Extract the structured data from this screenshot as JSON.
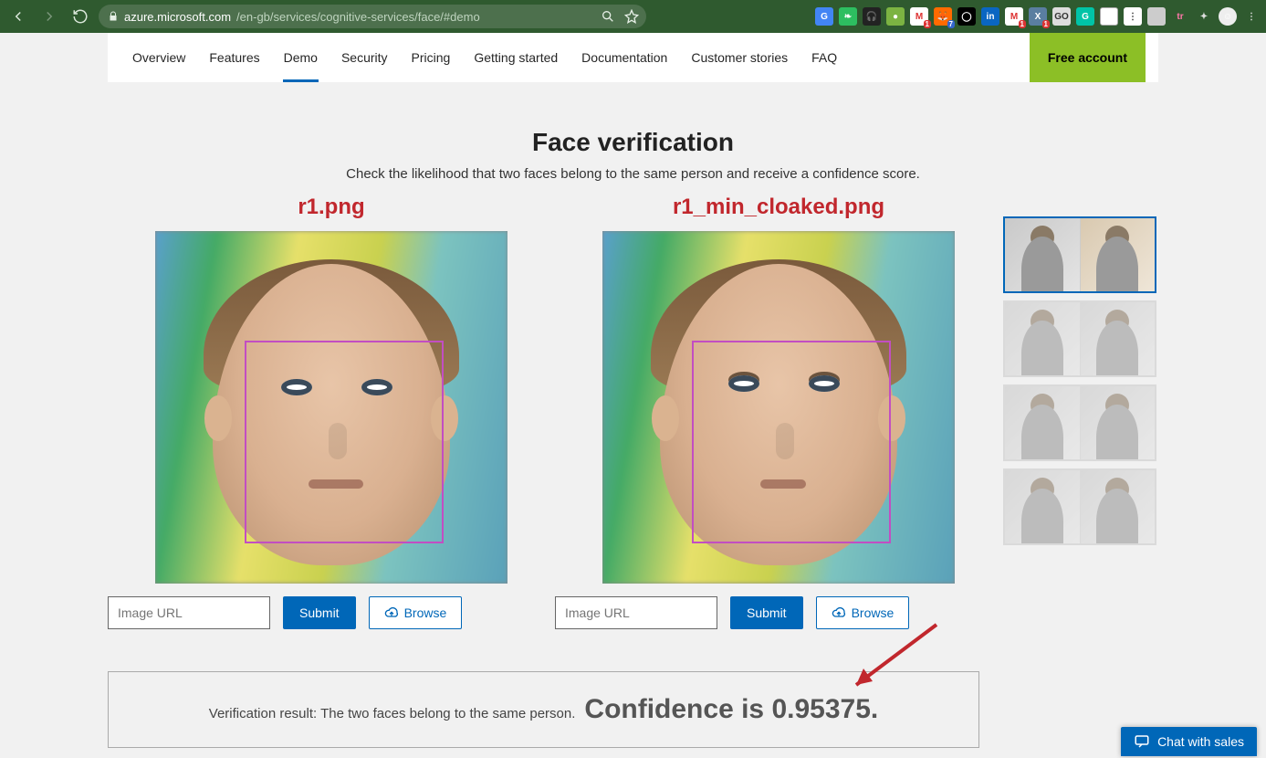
{
  "browser": {
    "url_host": "azure.microsoft.com",
    "url_path": "/en-gb/services/cognitive-services/face/#demo"
  },
  "ext_badges": {
    "gmail1": "1",
    "fox": "7",
    "gmail2": "1",
    "x": "1"
  },
  "secnav": {
    "items": [
      "Overview",
      "Features",
      "Demo",
      "Security",
      "Pricing",
      "Getting started",
      "Documentation",
      "Customer stories",
      "FAQ"
    ],
    "active_index": 2,
    "cta": "Free account"
  },
  "page": {
    "title": "Face verification",
    "subtitle": "Check the likelihood that two faces belong to the same person and receive a confidence score."
  },
  "annotations": {
    "left_filename": "r1.png",
    "right_filename": "r1_min_cloaked.png"
  },
  "controls": {
    "url_placeholder": "Image URL",
    "submit_label": "Submit",
    "browse_label": "Browse"
  },
  "result": {
    "prefix": "Verification result: The two faces belong to the same person.",
    "confidence_text": "Confidence is 0.95375."
  },
  "chat": {
    "label": "Chat with sales"
  },
  "thumbnails": {
    "count": 4,
    "selected": 0
  }
}
